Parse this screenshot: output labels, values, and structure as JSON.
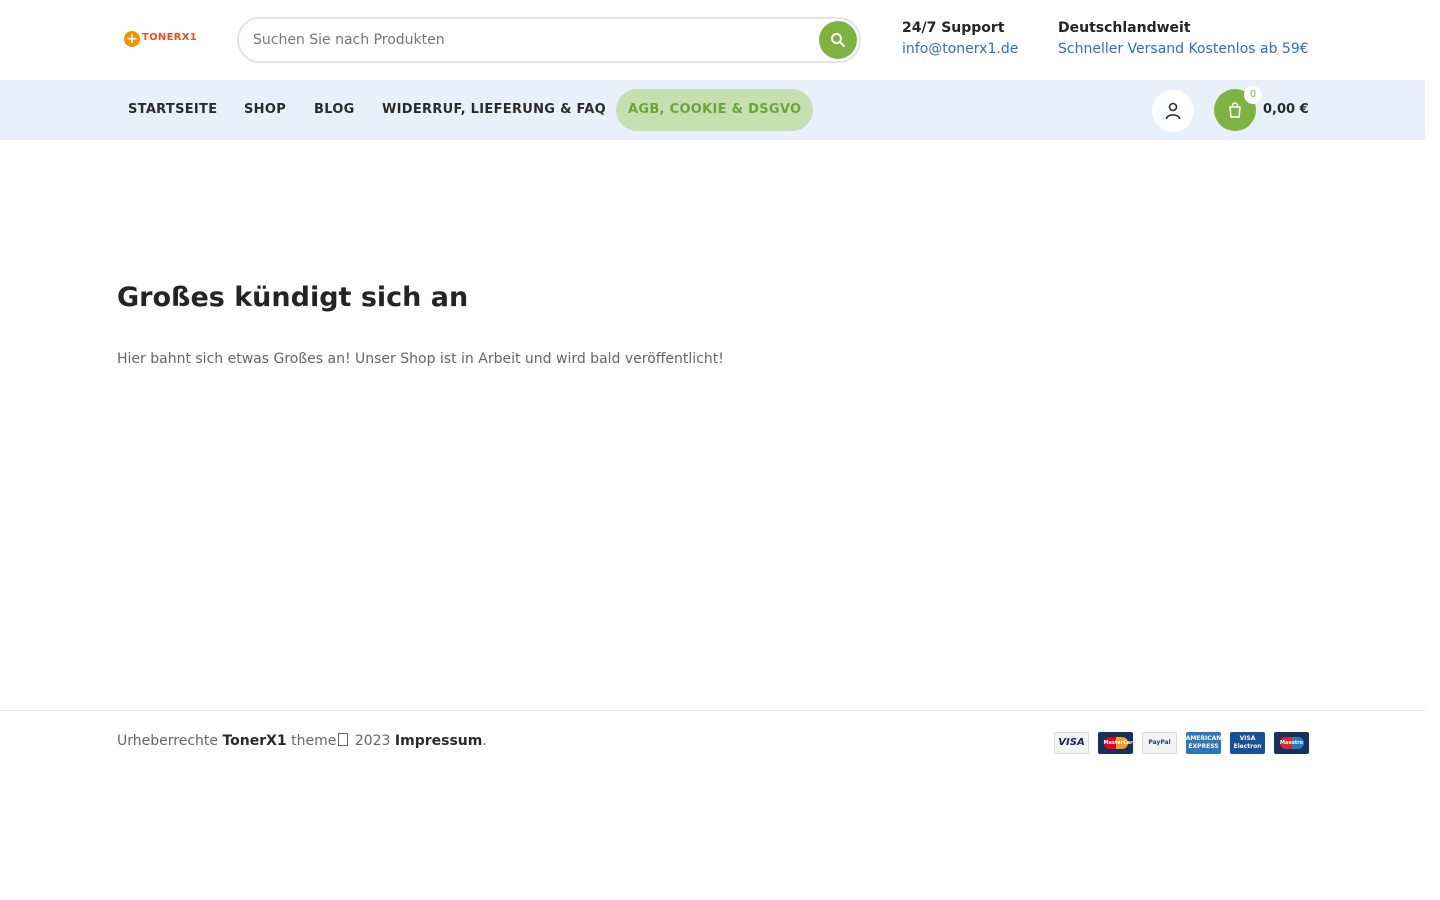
{
  "header": {
    "logo_text": "TONERX1",
    "search": {
      "placeholder": "Suchen Sie nach Produkten",
      "icon": "search-icon"
    },
    "support": {
      "title": "24/7 Support",
      "email": "info@tonerx1.de"
    },
    "shipping": {
      "title": "Deutschlandweit",
      "text": "Schneller Versand Kostenlos ab 59€"
    }
  },
  "nav": {
    "items": [
      {
        "label": "STARTSEITE"
      },
      {
        "label": "SHOP"
      },
      {
        "label": "BLOG"
      },
      {
        "label": "WIDERRUF, LIEFERUNG & FAQ"
      },
      {
        "label": "AGB, COOKIE & DSGVO",
        "active": true
      }
    ],
    "user_icon": "user-icon",
    "cart": {
      "icon": "cart-icon",
      "count": "0",
      "total": "0,00 €"
    }
  },
  "main": {
    "title": "Großes kündigt sich an",
    "text": "Hier bahnt sich etwas Großes an! Unser Shop ist in Arbeit und wird bald veröffentlicht!"
  },
  "footer": {
    "copyright_prefix": "Urheberrechte",
    "brand": "TonerX1",
    "middle": "theme",
    "year": "2023",
    "impressum": "Impressum",
    "suffix": ".",
    "payment_methods": [
      {
        "name": "VISA"
      },
      {
        "name": "MasterCard"
      },
      {
        "name": "PayPal"
      },
      {
        "name": "AMERICAN EXPRESS"
      },
      {
        "name": "VISA Electron"
      },
      {
        "name": "Maestro"
      }
    ]
  },
  "colors": {
    "accent_green": "#7cb342",
    "nav_background": "#e8f0fc",
    "link_blue": "#2a6fc9"
  }
}
